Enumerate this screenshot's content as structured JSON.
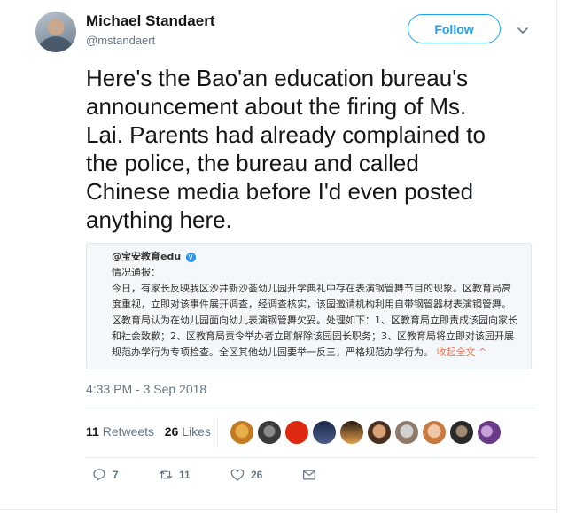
{
  "user": {
    "display_name": "Michael Standaert",
    "handle": "@mstandaert"
  },
  "follow_label": "Follow",
  "tweet": {
    "lines": [
      "Here's the Bao'an education bureau's",
      "announcement about the firing of Ms.",
      "Lai. Parents had already complained to",
      "the police, the bureau and called",
      "Chinese media before I'd even posted",
      "anything here."
    ],
    "timestamp": "4:33 PM - 3 Sep 2018"
  },
  "embed": {
    "author": "@宝安教育edu",
    "verified_mark": "V",
    "lines": [
      "情况通报：",
      "今日，有家长反映我区沙井新沙荟幼儿园开学典礼中存在表演钢管舞节目的现象。区教育局高",
      "度重视，立即对该事件展开调查，经调查核实，该园邀请机构利用自带钢管器材表演钢管舞。",
      "区教育局认为在幼儿园面向幼儿表演钢管舞欠妥。处理如下：1、区教育局立即责成该园向家长",
      "和社会致歉；2、区教育局责令举办者立即解除该园园长职务；3、区教育局将立即对该园开展",
      "规范办学行为专项检查。全区其他幼儿园要举一反三，严格规范办学行为。"
    ],
    "collapse_label": "收起全文 ^"
  },
  "stats": {
    "retweets_count": "11",
    "retweets_label": "Retweets",
    "likes_count": "26",
    "likes_label": "Likes"
  },
  "actions": {
    "reply_count": "7",
    "retweet_count": "11",
    "like_count": "26"
  },
  "colors": {
    "accent": "#1da1f2",
    "text": "#14171a",
    "muted": "#657786"
  }
}
